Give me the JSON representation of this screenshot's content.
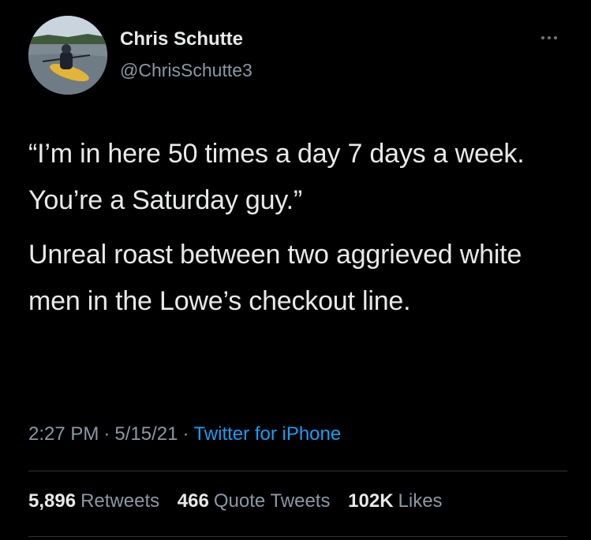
{
  "author": {
    "name": "Chris Schutte",
    "handle": "@ChrisSchutte3",
    "avatar_icon": "profile-photo-kayak"
  },
  "more_icon": "more-dots-icon",
  "tweet": {
    "paragraphs": [
      "“I’m in here 50 times a day 7 days a week. You’re a Saturday guy.”",
      "Unreal roast between two aggrieved white men in the Lowe’s checkout line."
    ]
  },
  "meta": {
    "time": "2:27 PM",
    "separator": "·",
    "date": "5/15/21",
    "source": "Twitter for iPhone"
  },
  "stats": {
    "retweets_count": "5,896",
    "retweets_label": "Retweets",
    "quotes_count": "466",
    "quotes_label": "Quote Tweets",
    "likes_count": "102K",
    "likes_label": "Likes"
  },
  "colors": {
    "background": "#000000",
    "primary_text": "#e7e9ea",
    "secondary_text": "#8b98a5",
    "link": "#1d9bf0",
    "divider": "#2f3336"
  }
}
